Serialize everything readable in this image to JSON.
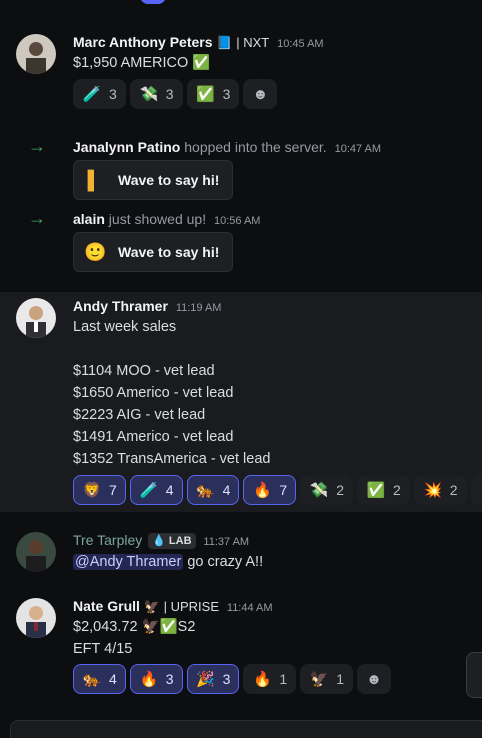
{
  "messages": {
    "marc": {
      "name": "Marc Anthony Peters",
      "flair": "📘 | NXT",
      "time": "10:45 AM",
      "text": "$1,950 AMERICO ✅",
      "reactions": [
        {
          "emoji": "🧪",
          "count": "3"
        },
        {
          "emoji": "💸",
          "count": "3"
        },
        {
          "emoji": "✅",
          "count": "3"
        }
      ]
    },
    "join1": {
      "name": "Janalynn Patino",
      "action": "hopped into the server.",
      "time": "10:47 AM",
      "button": "Wave to say hi!",
      "icon": "▌"
    },
    "join2": {
      "name": "alain",
      "action": "just showed up!",
      "time": "10:56 AM",
      "button": "Wave to say hi!",
      "icon": "🙂"
    },
    "andy": {
      "name": "Andy Thramer",
      "time": "11:19 AM",
      "lines": [
        "Last week sales",
        "$1104 MOO - vet lead",
        "$1650 Americo - vet lead",
        "$2223 AIG - vet lead",
        "$1491 Americo - vet lead",
        "$1352 TransAmerica - vet lead"
      ],
      "reactions": [
        {
          "emoji": "🦁",
          "count": "7"
        },
        {
          "emoji": "🧪",
          "count": "4"
        },
        {
          "emoji": "🐅",
          "count": "4"
        },
        {
          "emoji": "🔥",
          "count": "7"
        },
        {
          "emoji": "💸",
          "count": "2"
        },
        {
          "emoji": "✅",
          "count": "2"
        },
        {
          "emoji": "💥",
          "count": "2"
        }
      ]
    },
    "tre": {
      "name": "Tre Tarpley",
      "tag": "LAB",
      "tag_icon": "💧",
      "time": "11:37 AM",
      "mention": "@Andy Thramer",
      "text": " go crazy A!!"
    },
    "nate": {
      "name": "Nate Grull",
      "flair": "🦅 | UPRISE",
      "time": "11:44 AM",
      "line1": "$2,043.72 🦅✅S2",
      "line2": "EFT 4/15",
      "reactions": [
        {
          "emoji": "🐅",
          "count": "4"
        },
        {
          "emoji": "🔥",
          "count": "3"
        },
        {
          "emoji": "🎉",
          "count": "3"
        },
        {
          "emoji": "🔥",
          "count": "1"
        },
        {
          "emoji": "🦅",
          "count": "1"
        }
      ]
    }
  },
  "icons": {
    "add_reaction": "☻",
    "join_arrow": "→"
  },
  "colors": {
    "background": "#0d0e10",
    "highlight": "#1a1b1e",
    "accent": "#5865f2",
    "join_arrow": "#3ba55c"
  }
}
